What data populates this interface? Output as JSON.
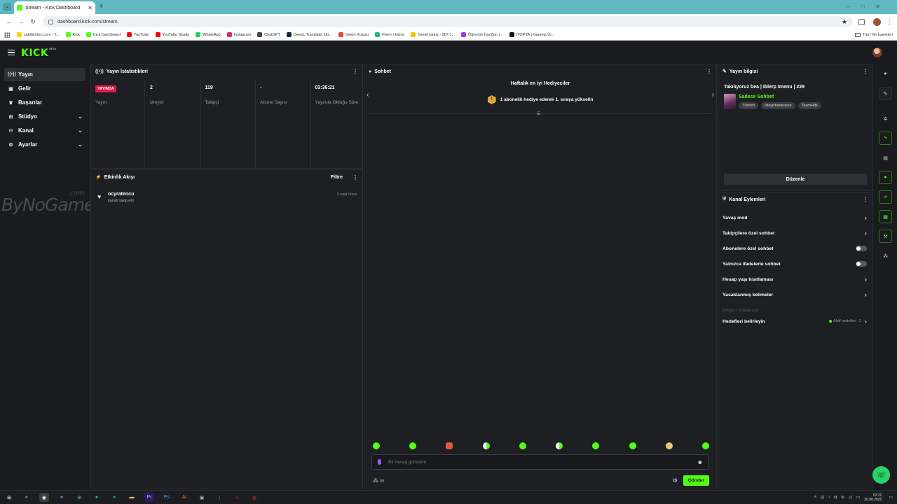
{
  "browser": {
    "tab_title": "Stream - Kick Dashboard",
    "url": "dashboard.kick.com/stream",
    "bookmarks": [
      {
        "label": "sahibinden.com - T...",
        "color": "#ffd400"
      },
      {
        "label": "Kick",
        "color": "#53fc18"
      },
      {
        "label": "Kick Dashboard",
        "color": "#53fc18"
      },
      {
        "label": "YouTube",
        "color": "#ff0000"
      },
      {
        "label": "YouTube Studio",
        "color": "#ff0000"
      },
      {
        "label": "WhatsApp",
        "color": "#25d366"
      },
      {
        "label": "Instagram",
        "color": "#d62976"
      },
      {
        "label": "ChatGPT",
        "color": "#444444"
      },
      {
        "label": "DeepL Translate: Dü...",
        "color": "#0f2b46"
      },
      {
        "label": "Gelen Kutusu",
        "color": "#ea4335"
      },
      {
        "label": "Fiverr / Inbox",
        "color": "#1dbf73"
      },
      {
        "label": "Genel bakış - 567-1...",
        "color": "#fbbc04"
      },
      {
        "label": "Öğrenim İçeriğim |...",
        "color": "#a435f0"
      },
      {
        "label": "ITOPYA | Gaming Ür...",
        "color": "#111111"
      }
    ],
    "all_bookmarks": "Tüm Yer İşaretleri"
  },
  "app": {
    "logo": "KICK",
    "logo_beta": "BETA"
  },
  "sidebar": {
    "items": [
      {
        "label": "Yayın",
        "icon": "live-icon",
        "glyph": "((•))",
        "active": true,
        "chevron": false
      },
      {
        "label": "Gelir",
        "icon": "revenue-icon",
        "glyph": "▣",
        "active": false,
        "chevron": false
      },
      {
        "label": "Başarılar",
        "icon": "trophy-icon",
        "glyph": "♛",
        "active": false,
        "chevron": false
      },
      {
        "label": "Stüdyo",
        "icon": "studio-icon",
        "glyph": "⊞",
        "active": false,
        "chevron": true
      },
      {
        "label": "Kanal",
        "icon": "channel-icon",
        "glyph": "⚇",
        "active": false,
        "chevron": true
      },
      {
        "label": "Ayarlar",
        "icon": "settings-icon",
        "glyph": "⚙",
        "active": false,
        "chevron": true
      }
    ],
    "watermark": "ByNoGame",
    "watermark_suffix": ".com"
  },
  "stats": {
    "title": "Yayın İstatistikleri",
    "live_badge": "YAYINDA",
    "live_label": "Yayın",
    "cells": [
      {
        "value": "2",
        "label": "İzleyici"
      },
      {
        "value": "119",
        "label": "Takipçi"
      },
      {
        "value": "-",
        "label": "Abone Sayısı"
      },
      {
        "value": "03:36:21",
        "label": "Yayında Olduğu Süre"
      }
    ]
  },
  "activity": {
    "title": "Etkinlik Akışı",
    "filter": "Filtre",
    "events": [
      {
        "user": "ocyratencu",
        "desc": "kanalı takip etti",
        "time": "2 saat önce"
      }
    ]
  },
  "chat": {
    "title": "Sohbet",
    "top_gifters_title": "Haftalık en iyi Hediyeciler",
    "gift_rank": "1",
    "gift_prompt": "1 abonelik hediye ederek 1. sıraya yükselin",
    "placeholder": "Bir mesaj gönderin",
    "send": "Gönder",
    "emotes": [
      "green",
      "green",
      "red",
      "mix",
      "green",
      "mix",
      "green",
      "green",
      "skin",
      "green"
    ]
  },
  "stream_info": {
    "title": "Yayın bilgisi",
    "stream_title": "Takılıyoruz bea | Iblerp Imenu | #29",
    "category": "Sadece Sohbet",
    "tags": [
      "Türkish",
      "izleyicilerleoyun",
      "TeamHds"
    ],
    "edit": "Düzenle"
  },
  "channel_actions": {
    "title": "Kanal Eylemleri",
    "rows": [
      {
        "label": "Yavaş mod",
        "control": "arrow"
      },
      {
        "label": "Takipçilere özel sohbet",
        "control": "arrow"
      },
      {
        "label": "Abonelere özel sohbet",
        "control": "toggle"
      },
      {
        "label": "Yalnızca ifadelerle sohbet",
        "control": "toggle"
      },
      {
        "label": "Hesap yaşı kısıtlaması",
        "control": "arrow"
      },
      {
        "label": "Yasaklanmış kelimeler",
        "control": "arrow"
      },
      {
        "label": "İzleyici Yönlendir",
        "control": "none"
      }
    ],
    "goals_label": "Hedefleri belirleyin",
    "goals_status": "Aktif hedefler - 2"
  },
  "taskbar": {
    "time": "02:21",
    "date": "26.08.2025"
  },
  "colors": {
    "accent": "#53fc18",
    "live": "#e0184a",
    "panel": "#1d1f23"
  }
}
